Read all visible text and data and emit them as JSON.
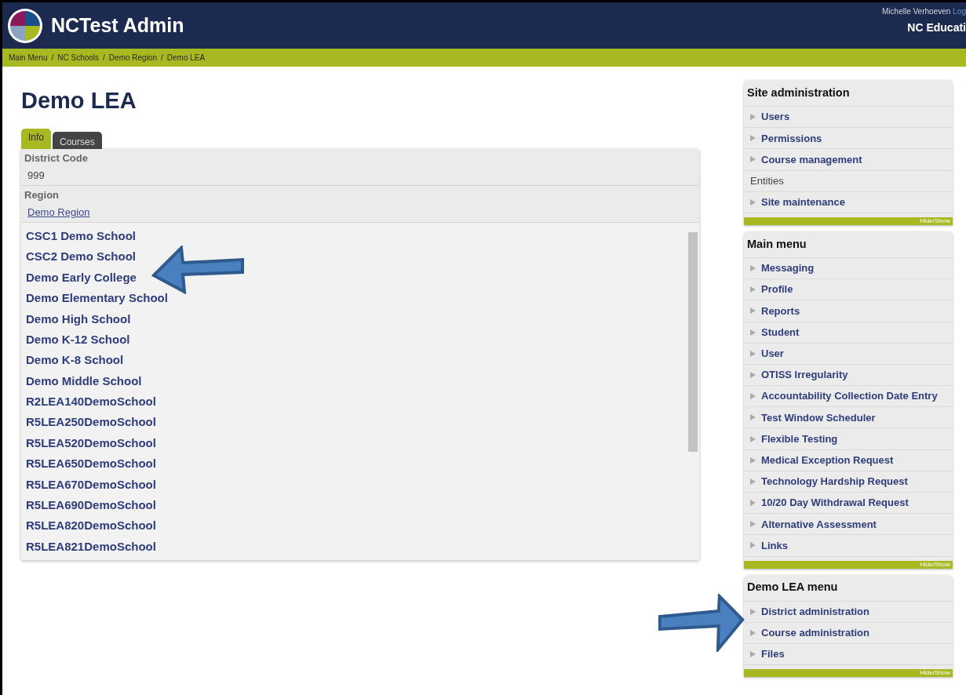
{
  "header": {
    "title": "NCTest Admin",
    "user": "Michelle Verhoeven",
    "logout": "Log",
    "org": "NC Educati"
  },
  "breadcrumb": [
    {
      "kind": "link",
      "text": "Main Menu"
    },
    {
      "kind": "separator",
      "text": "/"
    },
    {
      "kind": "link",
      "text": "NC Schools"
    },
    {
      "kind": "separator",
      "text": "/"
    },
    {
      "kind": "link",
      "text": "Demo Region"
    },
    {
      "kind": "separator",
      "text": "/"
    },
    {
      "kind": "link",
      "text": "Demo LEA"
    }
  ],
  "page_title": "Demo LEA",
  "tabs": [
    {
      "label": "Info",
      "selected": true
    },
    {
      "label": "Courses",
      "selected": false
    }
  ],
  "fields": [
    {
      "label": "District Code",
      "value": "999",
      "kind": "text"
    },
    {
      "label": "Region",
      "value": "Demo Region",
      "kind": "link"
    }
  ],
  "schools": [
    "CSC1 Demo School",
    "CSC2 Demo School",
    "Demo Early College",
    "Demo Elementary School",
    "Demo High School",
    "Demo K-12 School",
    "Demo K-8 School",
    "Demo Middle School",
    "R2LEA140DemoSchool",
    "R5LEA250DemoSchool",
    "R5LEA520DemoSchool",
    "R5LEA650DemoSchool",
    "R5LEA670DemoSchool",
    "R5LEA690DemoSchool",
    "R5LEA820DemoSchool",
    "R5LEA821DemoSchool"
  ],
  "blocks": [
    {
      "title": "Site administration",
      "footer": "Hide/Show",
      "items": [
        {
          "label": "Users",
          "expandable": true
        },
        {
          "label": "Permissions",
          "expandable": true
        },
        {
          "label": "Course management",
          "expandable": true
        },
        {
          "label": "Entities",
          "expandable": false
        },
        {
          "label": "Site maintenance",
          "expandable": true
        }
      ]
    },
    {
      "title": "Main menu",
      "footer": "Hide/Show",
      "items": [
        {
          "label": "Messaging",
          "expandable": true
        },
        {
          "label": "Profile",
          "expandable": true
        },
        {
          "label": "Reports",
          "expandable": true
        },
        {
          "label": "Student",
          "expandable": true
        },
        {
          "label": "User",
          "expandable": true
        },
        {
          "label": "OTISS Irregularity",
          "expandable": true
        },
        {
          "label": "Accountability Collection Date Entry",
          "expandable": true
        },
        {
          "label": "Test Window Scheduler",
          "expandable": true
        },
        {
          "label": "Flexible Testing",
          "expandable": true
        },
        {
          "label": "Medical Exception Request",
          "expandable": true
        },
        {
          "label": "Technology Hardship Request",
          "expandable": true
        },
        {
          "label": "10/20 Day Withdrawal Request",
          "expandable": true
        },
        {
          "label": "Alternative Assessment",
          "expandable": true
        },
        {
          "label": "Links",
          "expandable": true
        }
      ]
    },
    {
      "title": "Demo LEA menu",
      "footer": "Hide/Show",
      "items": [
        {
          "label": "District administration",
          "expandable": true
        },
        {
          "label": "Course administration",
          "expandable": true
        },
        {
          "label": "Files",
          "expandable": true
        }
      ]
    }
  ]
}
